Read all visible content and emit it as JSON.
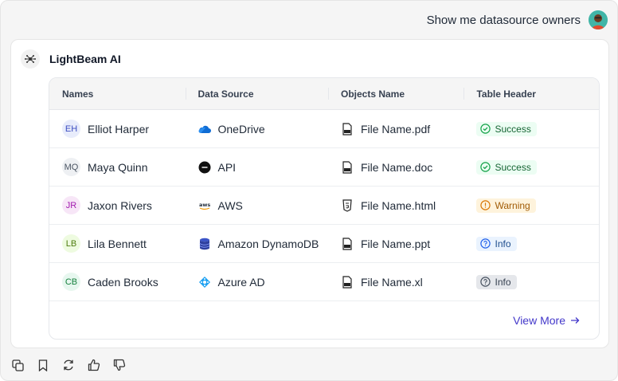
{
  "user_message": {
    "text": "Show me datasource owners"
  },
  "assistant": {
    "name": "LightBeam AI"
  },
  "table": {
    "headers": [
      "Names",
      "Data Source",
      "Objects Name",
      "Table Header"
    ],
    "rows": [
      {
        "initials": "EH",
        "name": "Elliot Harper",
        "source": "OneDrive",
        "source_icon": "onedrive-icon",
        "object": "File Name.pdf",
        "object_icon": "pdf-file-icon",
        "status": "Success",
        "status_type": "success"
      },
      {
        "initials": "MQ",
        "name": "Maya Quinn",
        "source": "API",
        "source_icon": "api-icon",
        "object": "File Name.doc",
        "object_icon": "doc-file-icon",
        "status": "Success",
        "status_type": "success"
      },
      {
        "initials": "JR",
        "name": "Jaxon Rivers",
        "source": "AWS",
        "source_icon": "aws-icon",
        "object": "File Name.html",
        "object_icon": "html-file-icon",
        "status": "Warning",
        "status_type": "warning"
      },
      {
        "initials": "LB",
        "name": "Lila Bennett",
        "source": "Amazon DynamoDB",
        "source_icon": "dynamodb-icon",
        "object": "File Name.ppt",
        "object_icon": "ppt-file-icon",
        "status": "Info",
        "status_type": "info"
      },
      {
        "initials": "CB",
        "name": "Caden Brooks",
        "source": "Azure AD",
        "source_icon": "azure-ad-icon",
        "object": "File Name.xl",
        "object_icon": "xl-file-icon",
        "status": "Info",
        "status_type": "info-gray"
      }
    ],
    "view_more": "View More"
  },
  "colors": {
    "accent": "#4338ca",
    "success": "#166534",
    "warning": "#a15c07",
    "info": "#1e4d8c"
  },
  "actions": [
    "copy-icon",
    "bookmark-icon",
    "regenerate-icon",
    "thumbs-up-icon",
    "thumbs-down-icon"
  ]
}
